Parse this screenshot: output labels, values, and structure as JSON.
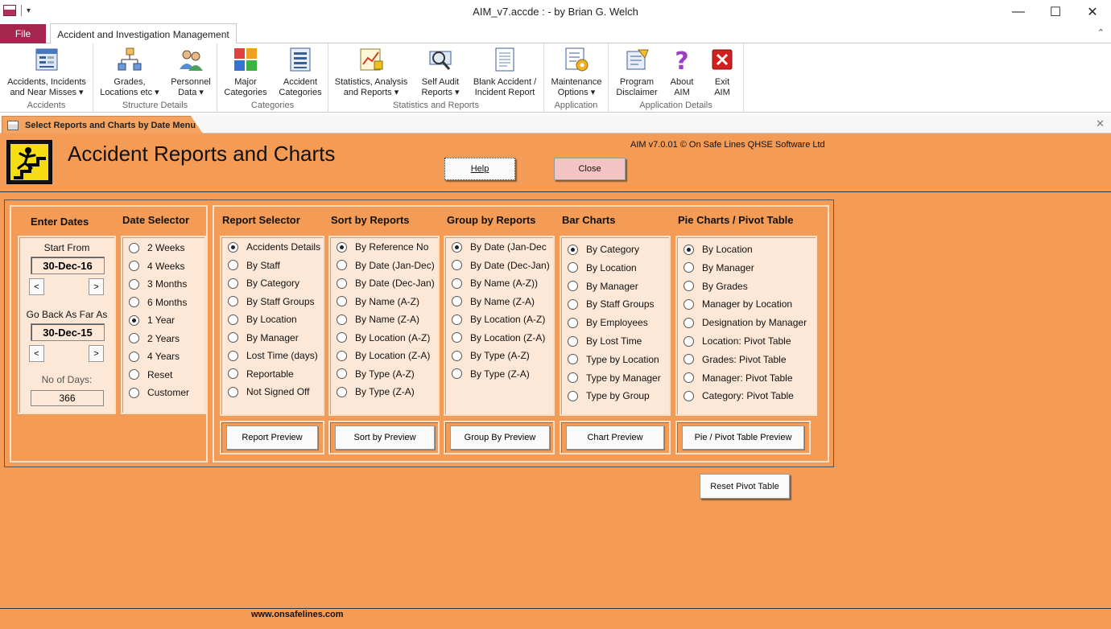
{
  "window": {
    "title": "AIM_v7.accde :  - by Brian G. Welch",
    "minimize": "—",
    "maximize": "☐",
    "close": "✕"
  },
  "ribbon_tabs": {
    "file": "File",
    "main": "Accident and Investigation Management"
  },
  "ribbon": {
    "groups": [
      {
        "label": "Accidents",
        "buttons": [
          {
            "label": "Accidents, Incidents\nand Near Misses ▾"
          }
        ]
      },
      {
        "label": "Structure Details",
        "buttons": [
          {
            "label": "Grades,\nLocations etc ▾"
          },
          {
            "label": "Personnel\nData ▾"
          }
        ]
      },
      {
        "label": "Categories",
        "buttons": [
          {
            "label": "Major\nCategories"
          },
          {
            "label": "Accident\nCategories"
          }
        ]
      },
      {
        "label": "Statistics and Reports",
        "buttons": [
          {
            "label": "Statistics, Analysis\nand Reports ▾"
          },
          {
            "label": "Self Audit\nReports ▾"
          },
          {
            "label": "Blank Accident /\nIncident Report"
          }
        ]
      },
      {
        "label": "Application",
        "buttons": [
          {
            "label": "Maintenance\nOptions ▾"
          }
        ]
      },
      {
        "label": "Application Details",
        "buttons": [
          {
            "label": "Program\nDisclaimer"
          },
          {
            "label": "About\nAIM"
          },
          {
            "label": "Exit\nAIM"
          }
        ]
      }
    ]
  },
  "form_tab": {
    "title": "Select Reports and Charts by Date Menu",
    "close": "✕"
  },
  "form": {
    "title": "Accident Reports and Charts",
    "copyright": "AIM v7.0.01 © On Safe Lines QHSE Software Ltd",
    "help_button": "Help",
    "close_button": "Close",
    "reset_pivot_button": "Reset Pivot Table",
    "footer": "www.onsafelines.com"
  },
  "enter_dates": {
    "heading": "Enter Dates",
    "start_label": "Start From",
    "start_value": "30-Dec-16",
    "back_label": "Go Back As Far As",
    "back_value": "30-Dec-15",
    "prev": "<",
    "next": ">",
    "days_label": "No of Days:",
    "days_value": "366"
  },
  "date_selector": {
    "heading": "Date Selector",
    "options": [
      "2  Weeks",
      "4  Weeks",
      "3 Months",
      "6 Months",
      "1 Year",
      "2 Years",
      "4 Years",
      "Reset",
      "Customer"
    ],
    "selected": 4
  },
  "report_selector": {
    "heading": "Report Selector",
    "options": [
      "Accidents Details",
      "By Staff",
      "By Category",
      "By Staff Groups",
      "By Location",
      "By Manager",
      "Lost Time (days)",
      "Reportable",
      "Not Signed Off"
    ],
    "selected": 0,
    "preview": "Report Preview"
  },
  "sort_by": {
    "heading": "Sort by Reports",
    "options": [
      "By Reference No",
      "By Date (Jan-Dec)",
      "By Date (Dec-Jan)",
      "By Name  (A-Z)",
      "By Name  (Z-A)",
      "By Location  (A-Z)",
      "By Location  (Z-A)",
      "By Type  (A-Z)",
      "By Type  (Z-A)"
    ],
    "selected": 0,
    "preview": "Sort by Preview"
  },
  "group_by": {
    "heading": "Group by Reports",
    "options": [
      "By Date (Jan-Dec",
      "By Date (Dec-Jan)",
      "By Name  (A-Z))",
      "By Name  (Z-A)",
      "By Location  (A-Z)",
      "By Location  (Z-A)",
      "By Type  (A-Z)",
      "By Type  (Z-A)"
    ],
    "selected": 0,
    "preview": "Group By Preview"
  },
  "bar_charts": {
    "heading": "Bar Charts",
    "options": [
      "By Category",
      "By Location",
      "By Manager",
      "By Staff Groups",
      "By Employees",
      "By Lost Time",
      "Type by Location",
      "Type by Manager",
      "Type by Group"
    ],
    "selected": 0,
    "preview": "Chart Preview"
  },
  "pie_charts": {
    "heading": "Pie Charts / Pivot Table",
    "options": [
      "By Location",
      "By Manager",
      "By Grades",
      "Manager by Location",
      "Designation by Manager",
      "Location: Pivot Table",
      "Grades: Pivot Table",
      "Manager: Pivot Table",
      "Category: Pivot Table"
    ],
    "selected": 0,
    "preview": "Pie / Pivot Table  Preview"
  }
}
